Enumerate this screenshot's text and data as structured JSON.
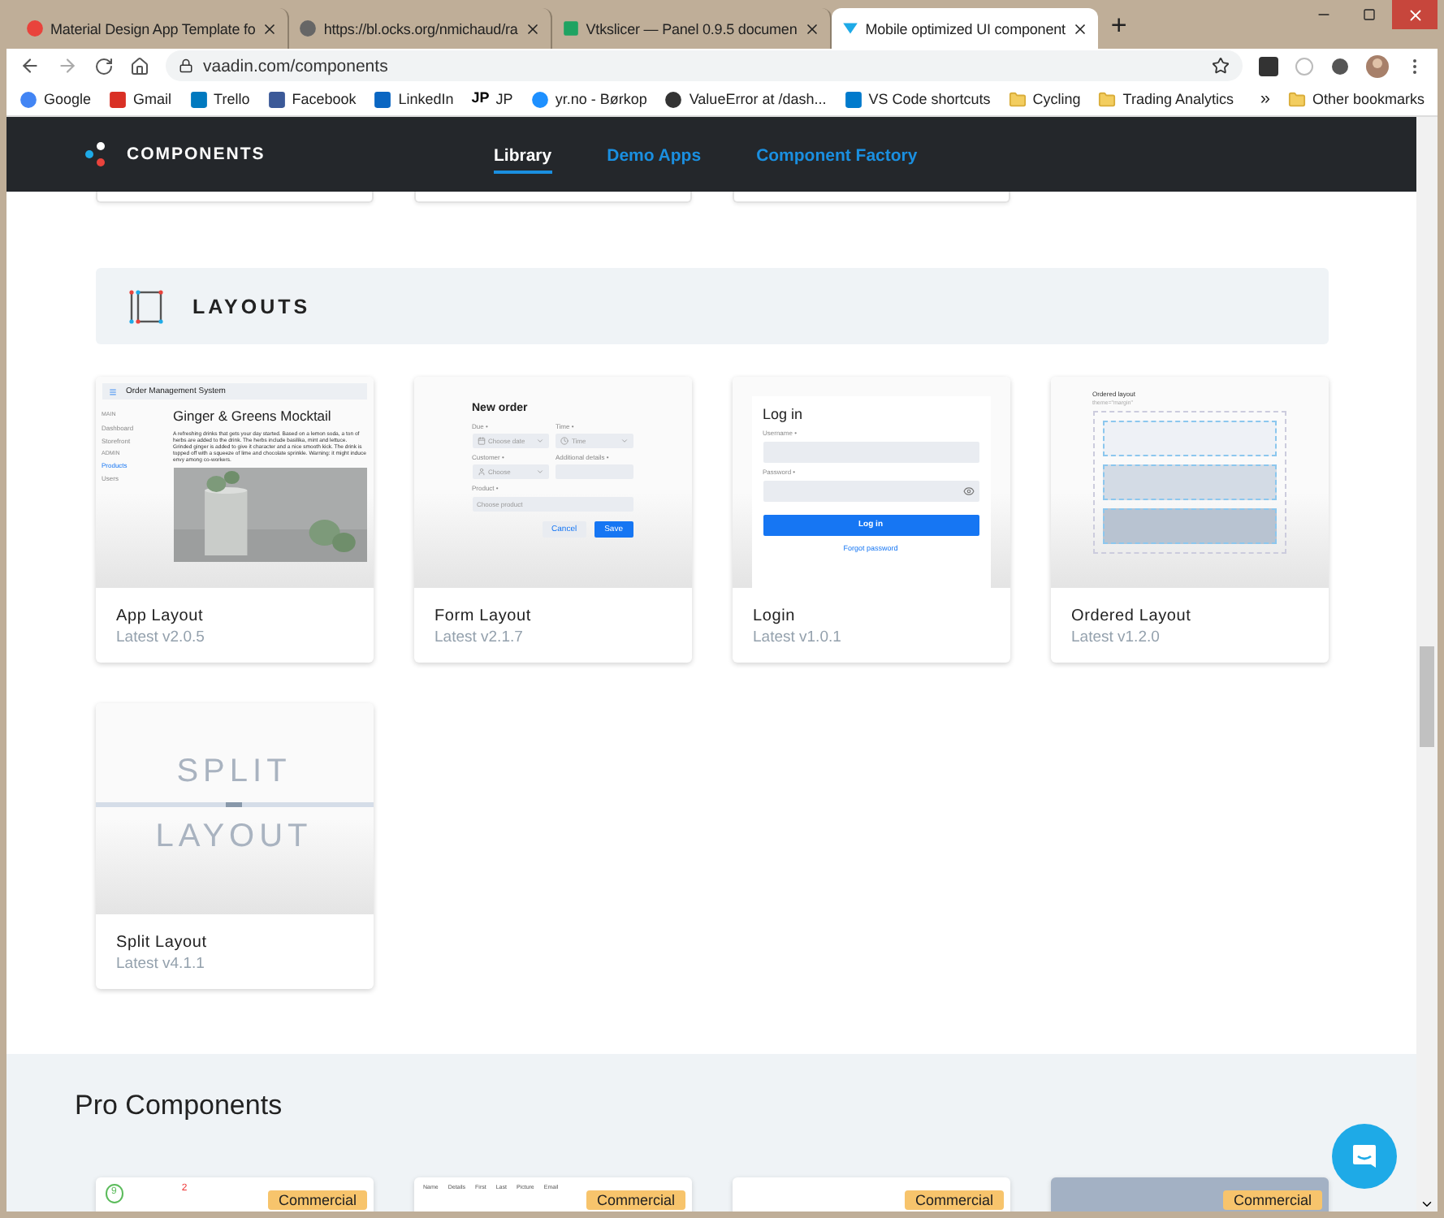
{
  "browser": {
    "tabs": [
      {
        "title": "Material Design App Template fo",
        "selected": false
      },
      {
        "title": "https://bl.ocks.org/nmichaud/ra",
        "selected": false
      },
      {
        "title": "Vtkslicer — Panel 0.9.5 documen",
        "selected": false
      },
      {
        "title": "Mobile optimized UI component",
        "selected": true
      }
    ],
    "new_tab": "+",
    "address": "vaadin.com/components",
    "bookmarks": [
      {
        "label": "Google"
      },
      {
        "label": "Gmail"
      },
      {
        "label": "Trello"
      },
      {
        "label": "Facebook"
      },
      {
        "label": "LinkedIn"
      },
      {
        "label": "JP",
        "mark": "JP"
      },
      {
        "label": "yr.no - Børkop"
      },
      {
        "label": "ValueError at /dash..."
      },
      {
        "label": "VS Code shortcuts"
      },
      {
        "label": "Cycling"
      },
      {
        "label": "Trading Analytics"
      }
    ],
    "more": "»",
    "other_bookmarks": "Other bookmarks"
  },
  "site_header": {
    "brand": "COMPONENTS",
    "nav": [
      {
        "label": "Library",
        "selected": true
      },
      {
        "label": "Demo Apps",
        "selected": false
      },
      {
        "label": "Component Factory",
        "selected": false
      }
    ]
  },
  "section": {
    "title": "LAYOUTS",
    "cards": [
      {
        "name": "App Layout",
        "version": "Latest v2.0.5",
        "thumb": {
          "kind": "app",
          "texts": [
            "Order Management System",
            "MAIN",
            "Dashboard",
            "Storefront",
            "ADMIN",
            "Products",
            "Users",
            "Ginger & Greens Mocktail",
            "A refreshing drinks that gets your day started. Based on a lemon soda, a ton of herbs are added to the drink. The herbs include basilika, mint and lettuce. Grinded ginger is added to give it character and a nice smooth kick. The drink is topped off with a squeeze of lime and chocolate sprinkle. Warning: it might induce envy among co-workers."
          ]
        }
      },
      {
        "name": "Form Layout",
        "version": "Latest v2.1.7",
        "thumb": {
          "kind": "form",
          "texts": [
            "New order",
            "Due •",
            "Time •",
            "Choose date",
            "Time",
            "Customer •",
            "Additional details •",
            "Choose",
            "Product •",
            "Choose product",
            "Cancel",
            "Save"
          ]
        }
      },
      {
        "name": "Login",
        "version": "Latest v1.0.1",
        "thumb": {
          "kind": "login",
          "texts": [
            "Log in",
            "Username •",
            "Password •",
            "Log in",
            "Forgot password"
          ]
        }
      },
      {
        "name": "Ordered Layout",
        "version": "Latest v1.2.0",
        "thumb": {
          "kind": "ordered",
          "texts": [
            "Ordered layout",
            "theme=\"margin\""
          ]
        }
      },
      {
        "name": "Split Layout",
        "version": "Latest v4.1.1",
        "thumb": {
          "kind": "split",
          "texts": [
            "SPLIT",
            "LAYOUT"
          ]
        }
      }
    ]
  },
  "pro": {
    "title": "Pro Components",
    "cards": [
      {
        "badge": "Commercial",
        "thumb": {
          "kind": "chart",
          "texts": [
            "9",
            "2"
          ]
        }
      },
      {
        "badge": "Commercial",
        "thumb": {
          "kind": "grid",
          "texts": [
            "Name",
            "Details",
            "First",
            "Last",
            "Picture",
            "Email"
          ]
        }
      },
      {
        "badge": "Commercial",
        "thumb": {
          "kind": "blank"
        }
      },
      {
        "badge": "Commercial",
        "thumb": {
          "kind": "dark"
        }
      }
    ]
  }
}
